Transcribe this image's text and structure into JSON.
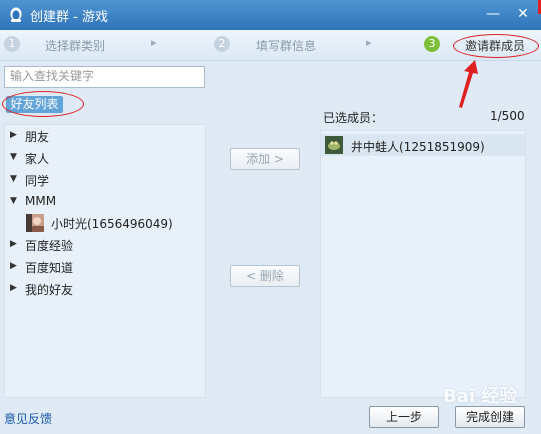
{
  "window": {
    "title": "创建群 - 游戏",
    "min_glyph": "—",
    "close_glyph": "✕"
  },
  "steps": [
    {
      "num": "1",
      "label": "选择群类别"
    },
    {
      "num": "2",
      "label": "填写群信息"
    },
    {
      "num": "3",
      "label": "邀请群成员"
    }
  ],
  "step_separator": "▸",
  "search": {
    "placeholder": "输入查找关键字",
    "value": ""
  },
  "tab_label": "好友列表",
  "groups": [
    {
      "label": "朋友",
      "expanded": false,
      "arrow": "▶"
    },
    {
      "label": "家人",
      "expanded": true,
      "arrow": "▼"
    },
    {
      "label": "同学",
      "expanded": true,
      "arrow": "▼"
    },
    {
      "label": "MMM",
      "expanded": true,
      "arrow": "▼"
    },
    {
      "label": "百度经验",
      "expanded": false,
      "arrow": "▶"
    },
    {
      "label": "百度知道",
      "expanded": false,
      "arrow": "▶"
    },
    {
      "label": "我的好友",
      "expanded": false,
      "arrow": "▶"
    }
  ],
  "friend": {
    "label": "小时光(1656496049)",
    "avatar_icon": "friend-avatar-icon"
  },
  "add_button": "添加 >",
  "remove_button": "< 删除",
  "selected": {
    "label": "已选成员：",
    "count": "1/500"
  },
  "member": {
    "label": "井中蛙人(1251851909)",
    "avatar_icon": "member-avatar-icon"
  },
  "footer": {
    "feedback": "意见反馈",
    "prev": "上一步",
    "finish": "完成创建"
  },
  "watermark": "Bai 经验",
  "colors": {
    "titlebar": "#3a80c4",
    "accent_red": "#e02020",
    "active_step": "#7dbf3a",
    "tab_bg": "#62a3d8",
    "panel_bg": "#e8f1fa"
  }
}
